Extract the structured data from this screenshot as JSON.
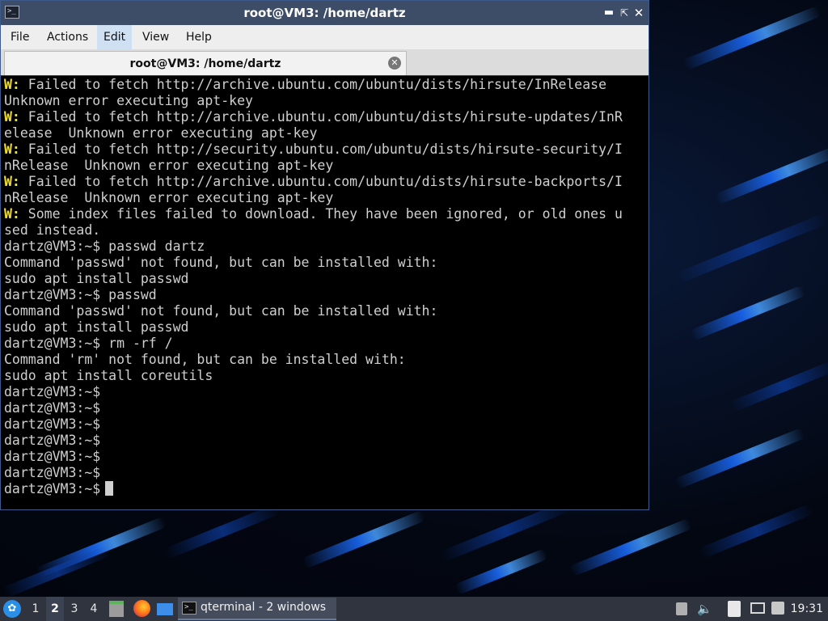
{
  "window": {
    "title": "root@VM3: /home/dartz",
    "menu": [
      "File",
      "Actions",
      "Edit",
      "View",
      "Help"
    ],
    "active_menu": "Edit",
    "tab_label": "root@VM3: /home/dartz"
  },
  "terminal": {
    "lines": [
      {
        "prefix": "W:",
        "text": " Failed to fetch http://archive.ubuntu.com/ubuntu/dists/hirsute/InRelease"
      },
      {
        "prefix": "",
        "text": "Unknown error executing apt-key"
      },
      {
        "prefix": "W:",
        "text": " Failed to fetch http://archive.ubuntu.com/ubuntu/dists/hirsute-updates/InR"
      },
      {
        "prefix": "",
        "text": "elease  Unknown error executing apt-key"
      },
      {
        "prefix": "W:",
        "text": " Failed to fetch http://security.ubuntu.com/ubuntu/dists/hirsute-security/I"
      },
      {
        "prefix": "",
        "text": "nRelease  Unknown error executing apt-key"
      },
      {
        "prefix": "W:",
        "text": " Failed to fetch http://archive.ubuntu.com/ubuntu/dists/hirsute-backports/I"
      },
      {
        "prefix": "",
        "text": "nRelease  Unknown error executing apt-key"
      },
      {
        "prefix": "W:",
        "text": " Some index files failed to download. They have been ignored, or old ones u"
      },
      {
        "prefix": "",
        "text": "sed instead."
      },
      {
        "prefix": "",
        "text": "dartz@VM3:~$ passwd dartz"
      },
      {
        "prefix": "",
        "text": "Command 'passwd' not found, but can be installed with:"
      },
      {
        "prefix": "",
        "text": "sudo apt install passwd"
      },
      {
        "prefix": "",
        "text": "dartz@VM3:~$ passwd"
      },
      {
        "prefix": "",
        "text": "Command 'passwd' not found, but can be installed with:"
      },
      {
        "prefix": "",
        "text": "sudo apt install passwd"
      },
      {
        "prefix": "",
        "text": "dartz@VM3:~$ rm -rf /"
      },
      {
        "prefix": "",
        "text": "Command 'rm' not found, but can be installed with:"
      },
      {
        "prefix": "",
        "text": "sudo apt install coreutils"
      },
      {
        "prefix": "",
        "text": "dartz@VM3:~$"
      },
      {
        "prefix": "",
        "text": "dartz@VM3:~$"
      },
      {
        "prefix": "",
        "text": "dartz@VM3:~$"
      },
      {
        "prefix": "",
        "text": "dartz@VM3:~$"
      },
      {
        "prefix": "",
        "text": "dartz@VM3:~$"
      },
      {
        "prefix": "",
        "text": "dartz@VM3:~$"
      }
    ],
    "prompt": "dartz@VM3:~$"
  },
  "taskbar": {
    "workspaces": [
      "1",
      "2",
      "3",
      "4"
    ],
    "active_workspace": "2",
    "task_label": "qterminal - 2 windows",
    "clock": "19:31"
  },
  "colors": {
    "warning": "#f0e030",
    "terminal_bg": "#000000",
    "titlebar": "#3d4d68",
    "taskbar": "#2f343f"
  }
}
